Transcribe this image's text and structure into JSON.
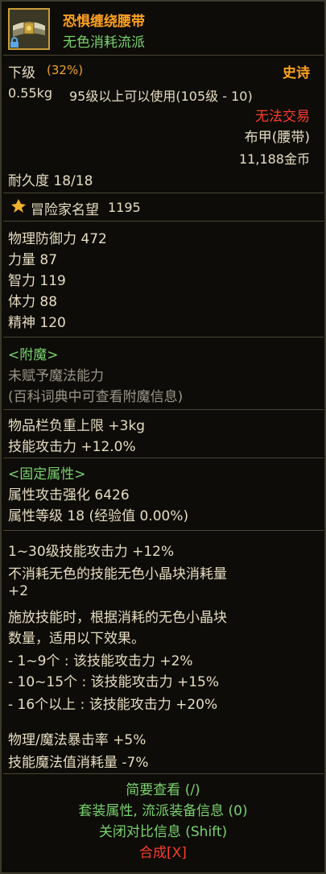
{
  "header": {
    "item_name": "恐惧缠绕腰带",
    "subtitle": "无色消耗流派",
    "icon": "belt-icon"
  },
  "grade": {
    "level_label": "下级",
    "percent": "(32%)",
    "rarity": "史诗"
  },
  "info": {
    "weight": "0.55kg",
    "level_req": "95级以上可以使用(105级 - 10)",
    "trade": "无法交易",
    "type": "布甲(腰带)",
    "price": "11,188金币",
    "durability": "耐久度 18/18"
  },
  "reputation": {
    "icon": "reputation-icon",
    "label": "冒险家名望",
    "value": "1195"
  },
  "stats": [
    {
      "name": "物理防御力",
      "value": "472"
    },
    {
      "name": "力量",
      "value": "87"
    },
    {
      "name": "智力",
      "value": "119"
    },
    {
      "name": "体力",
      "value": "88"
    },
    {
      "name": "精神",
      "value": "120"
    }
  ],
  "enchant": {
    "title": "<附魔>",
    "line1": "未赋予魔法能力",
    "line2": "(百科词典中可查看附魔信息)"
  },
  "extra": {
    "line1": "物品栏负重上限 +3kg",
    "line2": "技能攻击力 +12.0%"
  },
  "fixed": {
    "title": "<固定属性>",
    "line1": "属性攻击强化 6426",
    "line2": "属性等级 18 (经验值 0.00%)"
  },
  "options": {
    "lines": [
      "1~30级技能攻击力 +12%",
      "不消耗无色的技能无色小晶块消耗量",
      "+2",
      "施放技能时，根据消耗的无色小晶块",
      "数量，适用以下效果。",
      "- 1~9个 : 该技能攻击力 +2%",
      "- 10~15个 : 该技能攻击力 +15%",
      "- 16个以上 : 该技能攻击力 +20%"
    ],
    "crit": "物理/魔法暴击率 +5%",
    "mp": "技能魔法值消耗量 -7%"
  },
  "footer": {
    "brief": "简要查看 (/)",
    "set": "套装属性, 流派装备信息 (0)",
    "compare": "关闭对比信息 (Shift)",
    "compose": "合成[X]"
  },
  "colors": {
    "epic": "#ffa220",
    "red": "#ff3c2c",
    "green": "#7ad26e"
  }
}
